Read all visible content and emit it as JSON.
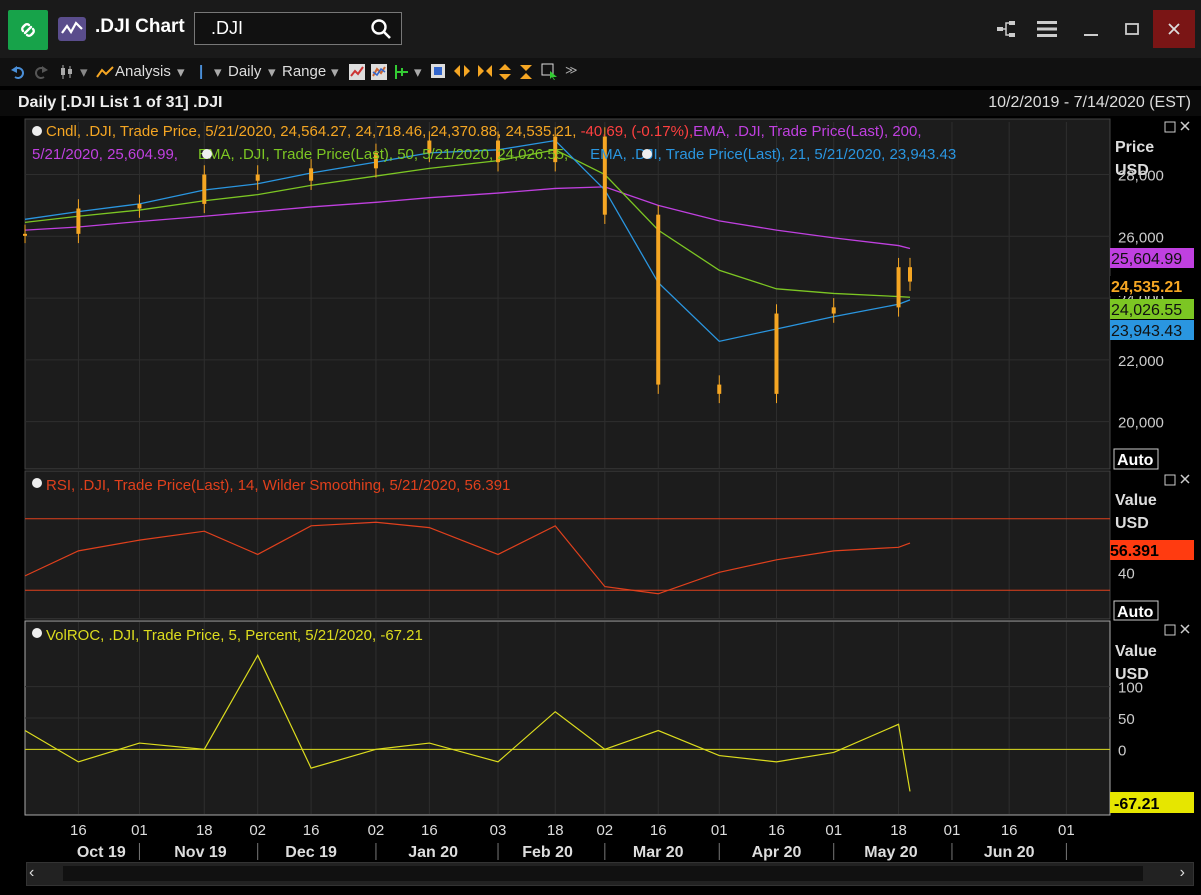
{
  "window": {
    "title": ".DJI Chart",
    "search_value": ".DJI",
    "search_placeholder": "",
    "colors": {
      "app_icon": "#17a34a",
      "close": "#7a1515"
    }
  },
  "toolbar": {
    "analysis_label": "Analysis",
    "interval_label": "Daily",
    "range_label": "Range"
  },
  "header": {
    "title": "Daily [.DJI List 1 of 31] .DJI",
    "date_range": "10/2/2019 - 7/14/2020 (EST)"
  },
  "chart_data": [
    {
      "type": "candlestick",
      "legend": {
        "cndl": "Cndl, .DJI, Trade Price, 5/21/2020, 24,564.27, 24,718.46, 24,370.88, 24,535.21, ",
        "cndl_change": "-40.69, (-0.17%),",
        "ema200": "EMA, .DJI, Trade Price(Last),  200,",
        "ema200_cont": "5/21/2020, 25,604.99,",
        "ema50": "EMA, .DJI, Trade Price(Last),  50, 5/21/2020, 24,026.55,",
        "ema21": "EMA, .DJI, Trade Price(Last),  21, 5/21/2020, 23,943.43"
      },
      "axis_title": "Price",
      "axis_unit": "USD",
      "yticks": [
        "28,000",
        "26,000",
        "24,000",
        "22,000",
        "20,000"
      ],
      "ylim": [
        18500,
        29700
      ],
      "x_dates": [
        "2019-10-02",
        "2019-10-16",
        "2019-11-01",
        "2019-11-18",
        "2019-12-02",
        "2019-12-16",
        "2020-01-02",
        "2020-01-16",
        "2020-02-03",
        "2020-02-18",
        "2020-03-02",
        "2020-03-16",
        "2020-04-01",
        "2020-04-16",
        "2020-05-01",
        "2020-05-18",
        "2020-05-21"
      ],
      "close": [
        26080,
        26900,
        27050,
        28000,
        27800,
        28200,
        28700,
        29100,
        28400,
        29230,
        26700,
        21200,
        20900,
        23500,
        23700,
        25000,
        24535.21
      ],
      "last_ohlc": {
        "date": "2020-05-21",
        "open": 24564.27,
        "high": 24718.46,
        "low": 24370.88,
        "close": 24535.21
      },
      "series": [
        {
          "name": "EMA 200",
          "color": "#c040e0",
          "last": "25,604.99",
          "values": [
            26200,
            26300,
            26480,
            26650,
            26800,
            26950,
            27100,
            27250,
            27400,
            27550,
            27600,
            27000,
            26500,
            26200,
            25950,
            25700,
            25604.99
          ]
        },
        {
          "name": "EMA 50",
          "color": "#7cc623",
          "last": "24,026.55",
          "values": [
            26450,
            26650,
            26850,
            27150,
            27350,
            27650,
            27950,
            28200,
            28450,
            28800,
            28000,
            26200,
            24900,
            24300,
            24150,
            24050,
            24026.55
          ]
        },
        {
          "name": "EMA 21",
          "color": "#2a96e0",
          "last": "23,943.43",
          "values": [
            26550,
            26800,
            27050,
            27500,
            27700,
            28050,
            28400,
            28700,
            28800,
            29100,
            27500,
            24500,
            22600,
            23000,
            23400,
            23800,
            23943.43
          ]
        }
      ],
      "last_close_label": "24,535.21",
      "auto_label": "Auto"
    },
    {
      "type": "line",
      "legend": "RSI, .DJI, Trade Price(Last),  14, Wilder Smoothing, 5/21/2020, 56.391",
      "axis_title": "Value",
      "axis_unit": "USD",
      "yticks": [
        "40"
      ],
      "ylim": [
        15,
        95
      ],
      "bands": [
        70,
        30
      ],
      "series": [
        {
          "name": "RSI",
          "color": "#e0401c",
          "values": [
            38,
            52,
            58,
            63,
            50,
            66,
            68,
            65,
            50,
            66,
            32,
            28,
            40,
            47,
            52,
            54,
            56.391
          ]
        }
      ],
      "last_label": "56.391",
      "auto_label": "Auto"
    },
    {
      "type": "line",
      "legend": "VolROC, .DJI, Trade Price,  5, Percent, 5/21/2020, -67.21",
      "axis_title": "Value",
      "axis_unit": "USD",
      "yticks": [
        "100",
        "50",
        "0"
      ],
      "ylim": [
        -100,
        200
      ],
      "series": [
        {
          "name": "VolROC",
          "color": "#dcdc1e",
          "values": [
            30,
            -20,
            10,
            0,
            150,
            -30,
            0,
            10,
            -20,
            60,
            0,
            30,
            -10,
            -20,
            -5,
            40,
            -67.21
          ]
        }
      ],
      "last_label": "-67.21",
      "x_tick_labels": [
        "16",
        "01",
        "18",
        "02",
        "16",
        "02",
        "16",
        "03",
        "18",
        "02",
        "16",
        "01",
        "16",
        "01",
        "18",
        "01",
        "16",
        "01"
      ],
      "month_labels": [
        "Oct 19",
        "Nov 19",
        "Dec 19",
        "Jan 20",
        "Feb 20",
        "Mar 20",
        "Apr 20",
        "May 20",
        "Jun 20"
      ]
    }
  ]
}
